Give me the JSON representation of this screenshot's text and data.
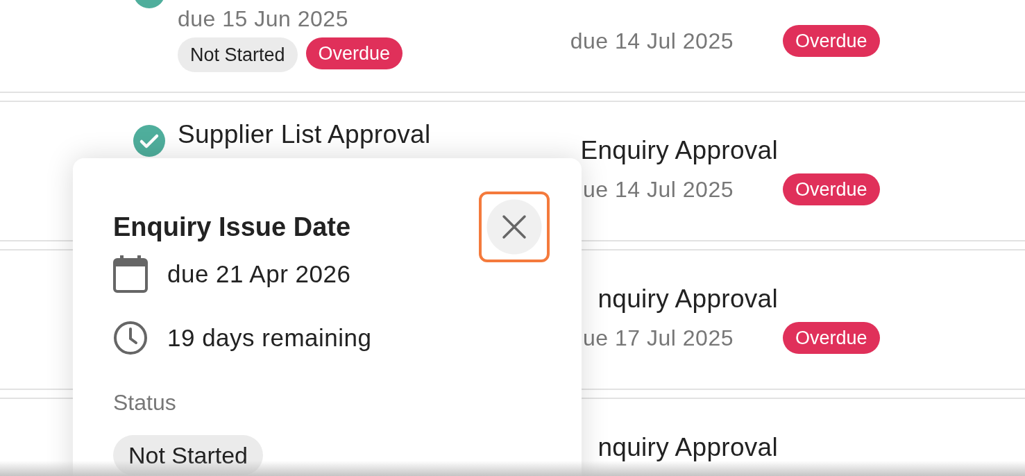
{
  "tasks": [
    {
      "left": {
        "due": "due 15 Jun 2025",
        "badges": [
          {
            "label": "Not Started",
            "kind": "status"
          },
          {
            "label": "Overdue",
            "kind": "overdue"
          }
        ]
      },
      "right": {
        "due": "due 14 Jul 2025",
        "badge": {
          "label": "Overdue",
          "kind": "overdue"
        }
      }
    },
    {
      "left": {
        "title": "Supplier List Approval"
      },
      "right": {
        "title": "Enquiry Approval",
        "due": "ue 14 Jul 2025",
        "badge": {
          "label": "Overdue",
          "kind": "overdue"
        }
      }
    },
    {
      "right": {
        "title": "nquiry Approval",
        "due": "ue 17 Jul 2025",
        "badge": {
          "label": "Overdue",
          "kind": "overdue"
        }
      }
    },
    {
      "right": {
        "title": "nquiry Approval"
      }
    }
  ],
  "popover": {
    "title": "Enquiry Issue Date",
    "due": "due 21 Apr 2026",
    "remaining": "19 days remaining",
    "status_label": "Status",
    "status": "Not Started"
  }
}
